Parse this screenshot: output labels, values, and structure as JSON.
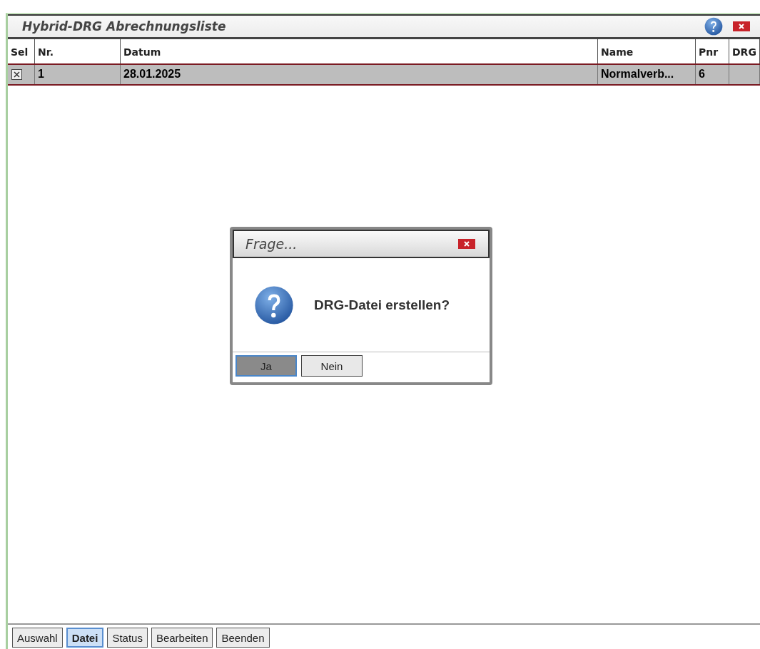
{
  "window": {
    "title": "Hybrid-DRG Abrechnungsliste"
  },
  "table": {
    "columns": [
      "Sel",
      "Nr.",
      "Datum",
      "Name",
      "Pnr",
      "DRG"
    ],
    "rows": [
      {
        "selected": true,
        "checked": true,
        "cells": [
          "",
          "1",
          "28.01.2025",
          "Normalverb...",
          "6",
          ""
        ]
      }
    ]
  },
  "dialog": {
    "title": "Frage...",
    "message": "DRG-Datei erstellen?",
    "buttons": [
      {
        "label": "Ja",
        "selected": true
      },
      {
        "label": "Nein",
        "selected": false
      }
    ]
  },
  "toolbar": [
    {
      "label": "Auswahl",
      "selected": false
    },
    {
      "label": "Datei",
      "selected": true
    },
    {
      "label": "Status",
      "selected": false
    },
    {
      "label": "Bearbeiten",
      "selected": false
    },
    {
      "label": "Beenden",
      "selected": false
    }
  ]
}
